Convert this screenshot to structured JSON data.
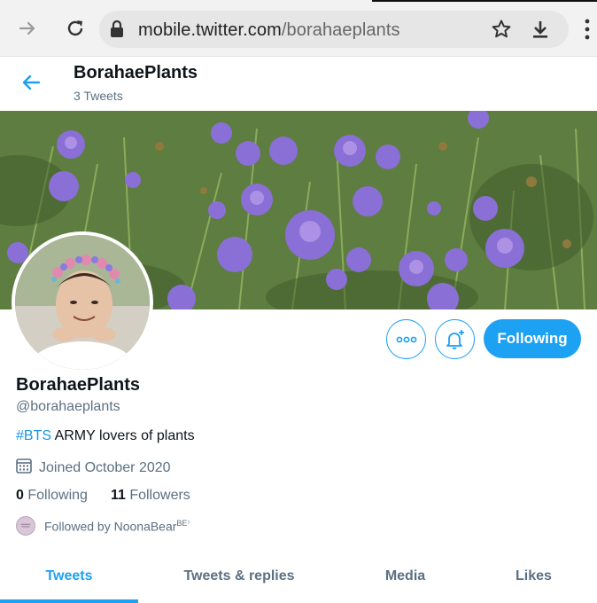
{
  "browser": {
    "url_host": "mobile.twitter.com",
    "url_path": "/borahaeplants",
    "icons": [
      "forward-arrow-icon",
      "reload-icon",
      "lock-icon",
      "star-icon",
      "download-icon",
      "more-vert-icon"
    ]
  },
  "header": {
    "name": "BorahaePlants",
    "tweet_count": "3 Tweets"
  },
  "profile": {
    "name": "BorahaePlants",
    "handle": "@borahaeplants",
    "bio_hashtag": "#BTS",
    "bio_text": " ARMY lovers of plants",
    "joined": "Joined October 2020",
    "following_count": "0",
    "following_label": "Following",
    "followers_count": "11",
    "followers_label": "Followers",
    "followed_by_prefix": "Followed by ",
    "followed_by_name": "NoonaBear",
    "followed_by_sup": "BE⁷",
    "follow_button": "Following"
  },
  "tabs": [
    {
      "label": "Tweets",
      "active": true
    },
    {
      "label": "Tweets & replies",
      "active": false
    },
    {
      "label": "Media",
      "active": false
    },
    {
      "label": "Likes",
      "active": false
    }
  ],
  "colors": {
    "accent": "#1da1f2",
    "hashtag": "#1b95e0",
    "secondary_text": "#5b7083"
  }
}
